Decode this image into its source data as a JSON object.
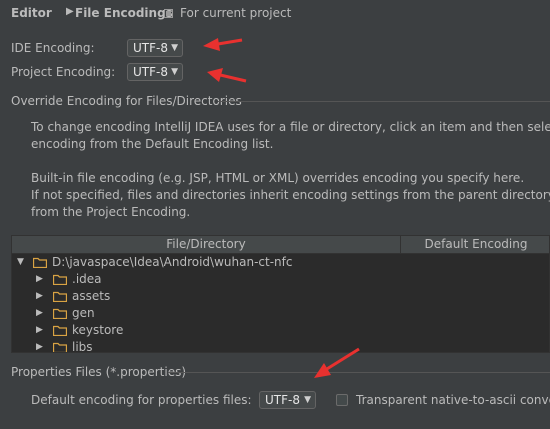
{
  "breadcrumb": {
    "section": "Editor",
    "separator": "▶",
    "page": "File Encodings"
  },
  "scope": {
    "label": "For current project",
    "icon": "project-scope-icon"
  },
  "ide_encoding": {
    "label": "IDE Encoding:",
    "value": "UTF-8"
  },
  "project_encoding": {
    "label": "Project Encoding:",
    "value": "UTF-8"
  },
  "override_group": {
    "title": "Override Encoding for Files/Directories",
    "desc_line1": "To change encoding IntelliJ IDEA uses for a file or directory, click an item and then select",
    "desc_line2": "encoding from the Default Encoding list.",
    "desc_line3": "Built-in file encoding (e.g. JSP, HTML or XML) overrides encoding you specify here.",
    "desc_line4": "If not specified, files and directories inherit encoding settings from the parent directory o",
    "desc_line5": "from the Project Encoding."
  },
  "table": {
    "col_file": "File/Directory",
    "col_encoding": "Default Encoding",
    "root": "D:\\javaspace\\Idea\\Android\\wuhan-ct-nfc",
    "children": [
      ".idea",
      "assets",
      "gen",
      "keystore",
      "libs"
    ]
  },
  "properties_group": {
    "title": "Properties Files (*.properties)",
    "default_label": "Default encoding for properties files:",
    "default_value": "UTF-8",
    "transparent_label": "Transparent native-to-ascii conve"
  },
  "colors": {
    "background": "#3c3f41",
    "text": "#bbbbbb",
    "folder": "#d9a343",
    "annotation_arrow": "#e8312f"
  }
}
